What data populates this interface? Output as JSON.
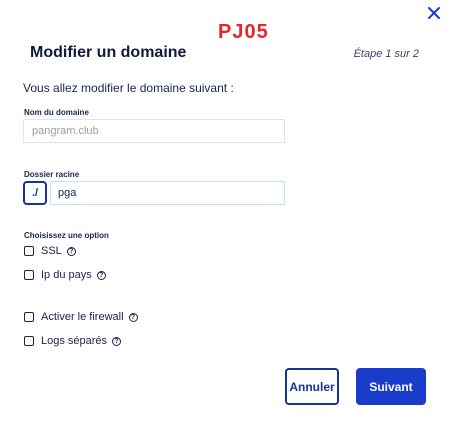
{
  "header": {
    "tag": "PJ05",
    "title": "Modifier un domaine",
    "step": "Étape 1 sur 2",
    "close_icon": "close-icon"
  },
  "form": {
    "intro": "Vous allez modifier le domaine suivant :",
    "domain_label": "Nom du domaine",
    "domain_value": "pangram.club",
    "root_label": "Dossier racine",
    "root_prefix": "./",
    "root_value": "pga",
    "options_label": "Choisissez une option",
    "options": [
      {
        "label": "SSL",
        "checked": false,
        "help": "?"
      },
      {
        "label": "Ip du pays",
        "checked": false,
        "help": "?"
      },
      {
        "label": "Activer le firewall",
        "checked": false,
        "help": "?"
      },
      {
        "label": "Logs séparés",
        "checked": false,
        "help": "?"
      }
    ]
  },
  "footer": {
    "cancel_label": "Annuler",
    "next_label": "Suivant"
  },
  "colors": {
    "primary": "#1a3ccb",
    "text": "#18234a",
    "tag_red": "#e3262f"
  }
}
